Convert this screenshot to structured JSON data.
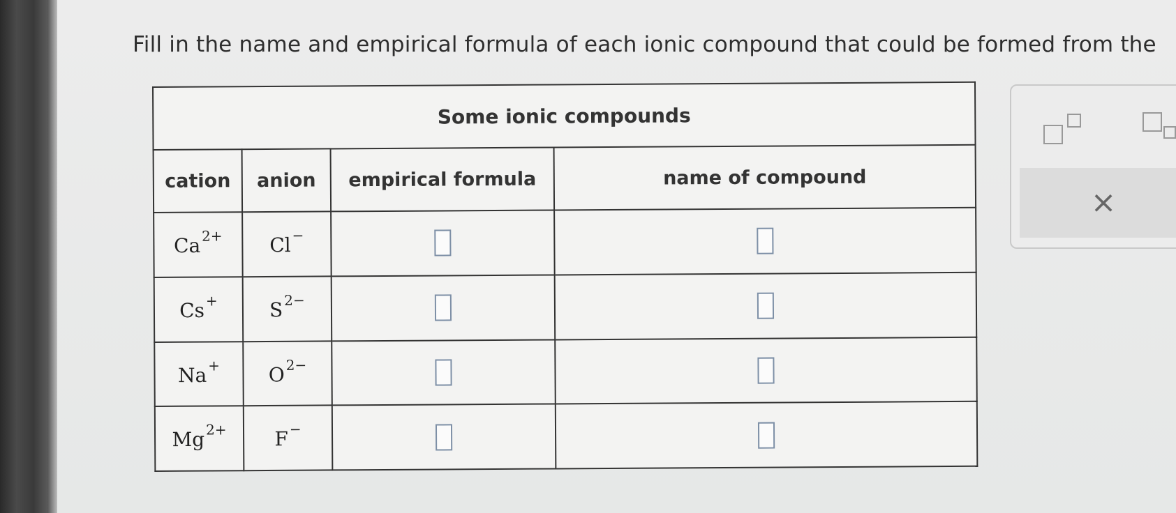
{
  "question": "Fill in the name and empirical formula of each ionic compound that could be formed from the",
  "table": {
    "title": "Some ionic compounds",
    "headers": [
      "cation",
      "anion",
      "empirical formula",
      "name of compound"
    ],
    "rows": [
      {
        "cation": {
          "symbol": "Ca",
          "charge": "2+"
        },
        "anion": {
          "symbol": "Cl",
          "charge": "−"
        }
      },
      {
        "cation": {
          "symbol": "Cs",
          "charge": "+"
        },
        "anion": {
          "symbol": "S",
          "charge": "2−"
        }
      },
      {
        "cation": {
          "symbol": "Na",
          "charge": "+"
        },
        "anion": {
          "symbol": "O",
          "charge": "2−"
        }
      },
      {
        "cation": {
          "symbol": "Mg",
          "charge": "2+"
        },
        "anion": {
          "symbol": "F",
          "charge": "−"
        }
      }
    ]
  },
  "toolbox": {
    "superscript_icon": "superscript-box-icon",
    "subscript_icon": "subscript-box-icon",
    "clear_label": "×"
  },
  "colors": {
    "answer_box_border": "#7d8fa6",
    "table_border": "#333333",
    "background": "#e9ebea"
  }
}
